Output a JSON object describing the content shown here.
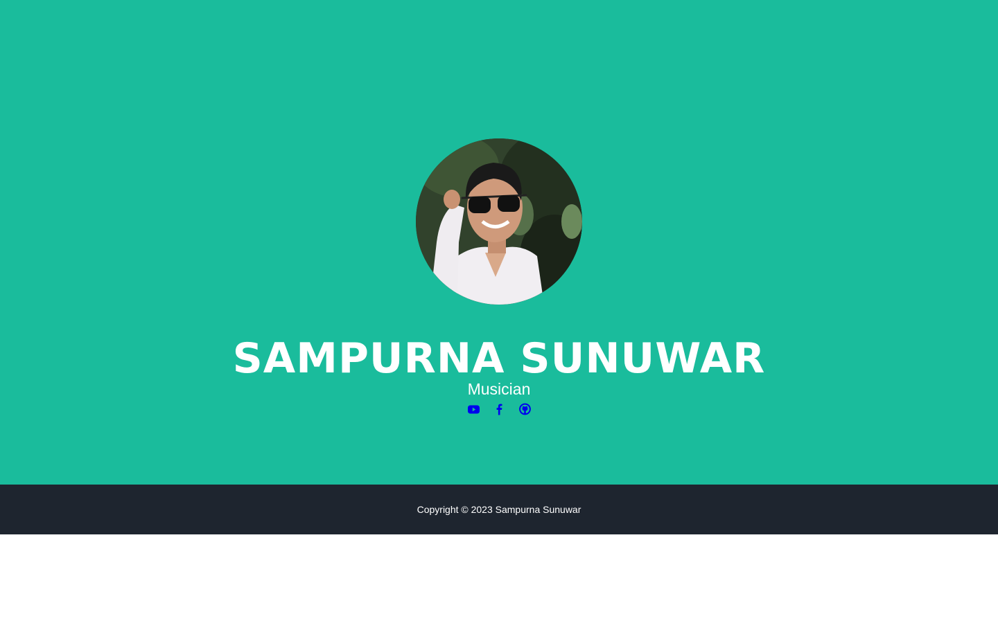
{
  "profile": {
    "name": "SAMPURNA SUNUWAR",
    "role": "Musician"
  },
  "social": [
    {
      "icon": "youtube-icon",
      "color": "#0000ee"
    },
    {
      "icon": "facebook-icon",
      "color": "#0000ee"
    },
    {
      "icon": "github-icon",
      "color": "#0000ee"
    }
  ],
  "footer": {
    "copyright": "Copyright © 2023 Sampurna Sunuwar"
  },
  "colors": {
    "hero_background": "#1abc9c",
    "footer_background": "#1e252f",
    "text": "#ffffff",
    "link": "#0000ee"
  }
}
